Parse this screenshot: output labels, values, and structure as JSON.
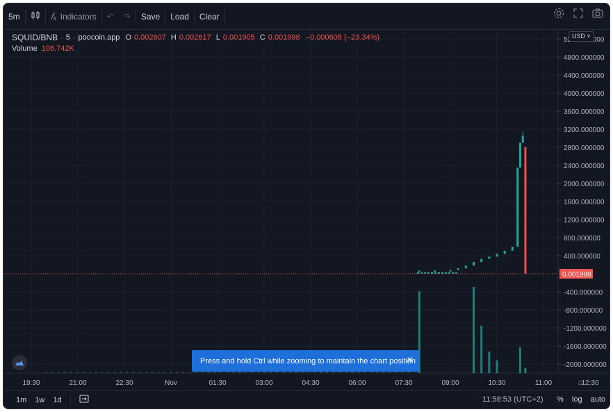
{
  "toolbar": {
    "interval": "5m",
    "candle_icon": "candles-icon",
    "indicators_icon": "fx-icon",
    "indicators_label": "Indicators",
    "undo_icon": "undo-icon",
    "redo_icon": "redo-icon",
    "save_label": "Save",
    "load_label": "Load",
    "clear_label": "Clear",
    "settings_icon": "gear-icon",
    "fullscreen_icon": "fullscreen-icon",
    "snapshot_icon": "camera-icon"
  },
  "legend": {
    "symbol": "SQUID/BNB",
    "interval": "5",
    "source": "poocoin.app",
    "o_label": "O",
    "o_value": "0.002607",
    "h_label": "H",
    "h_value": "0.002617",
    "l_label": "L",
    "l_value": "0.001905",
    "c_label": "C",
    "c_value": "0.001998",
    "change": "−0.000608 (−23.34%)",
    "volume_label": "Volume",
    "volume_value": "106.742K"
  },
  "currency": "USD",
  "price_axis": {
    "ticks": [
      "5200.000000",
      "4800.000000",
      "4400.000000",
      "4000.000000",
      "3600.000000",
      "3200.000000",
      "2800.000000",
      "2400.000000",
      "2000.000000",
      "1600.000000",
      "1200.000000",
      "800.000000",
      "400.000000",
      "-400.000000",
      "-800.000000",
      "-1200.000000",
      "-1600.000000",
      "-2000.000000"
    ],
    "current_price": "0.001998"
  },
  "time_axis": {
    "ticks": [
      "19:30",
      "21:00",
      "22:30",
      "Nov",
      "01:30",
      "03:00",
      "04:30",
      "06:00",
      "07:30",
      "09:00",
      "10:30",
      "11:00",
      "12:30"
    ]
  },
  "chart_data": {
    "type": "candlestick",
    "series": [
      {
        "name": "SQUID/BNB",
        "values": [
          {
            "t": "08:00",
            "o": 40,
            "c": 70
          },
          {
            "t": "08:30",
            "o": 70,
            "c": 75
          },
          {
            "t": "09:00",
            "o": 75,
            "c": 80
          },
          {
            "t": "09:15",
            "o": 80,
            "c": 120
          },
          {
            "t": "09:30",
            "o": 120,
            "c": 180
          },
          {
            "t": "09:45",
            "o": 180,
            "c": 260
          },
          {
            "t": "10:00",
            "o": 260,
            "c": 330
          },
          {
            "t": "10:15",
            "o": 330,
            "c": 380
          },
          {
            "t": "10:30",
            "o": 380,
            "c": 440
          },
          {
            "t": "10:45",
            "o": 440,
            "c": 510
          },
          {
            "t": "11:00",
            "o": 510,
            "c": 600
          },
          {
            "t": "11:10",
            "o": 600,
            "c": 2350
          },
          {
            "t": "11:15",
            "o": 2350,
            "c": 2900
          },
          {
            "t": "11:20",
            "o": 2900,
            "c": 3050
          },
          {
            "t": "11:25",
            "o": 2800,
            "c": 0
          }
        ]
      },
      {
        "name": "Volume",
        "values": [
          {
            "t": "08:00",
            "v": 95
          },
          {
            "t": "09:45",
            "v": 100
          },
          {
            "t": "10:00",
            "v": 55
          },
          {
            "t": "10:15",
            "v": 25
          },
          {
            "t": "10:30",
            "v": 15
          },
          {
            "t": "11:15",
            "v": 30
          },
          {
            "t": "11:25",
            "v": 6
          }
        ]
      }
    ],
    "ylim": [
      -2200,
      5400
    ]
  },
  "toast": {
    "message": "Press and hold Ctrl while zooming to maintain the chart position",
    "close_icon": "close-icon"
  },
  "bottombar": {
    "ranges": [
      "1m",
      "1w",
      "1d"
    ],
    "goto_icon": "goto-date-icon",
    "time": "11:58:53 (UTC+2)",
    "percent": "%",
    "log": "log",
    "auto": "auto"
  },
  "colors": {
    "background": "#131722",
    "up": "#26a69a",
    "down": "#ef5350",
    "grid": "#1e222d",
    "toast": "#1e6fd9"
  }
}
